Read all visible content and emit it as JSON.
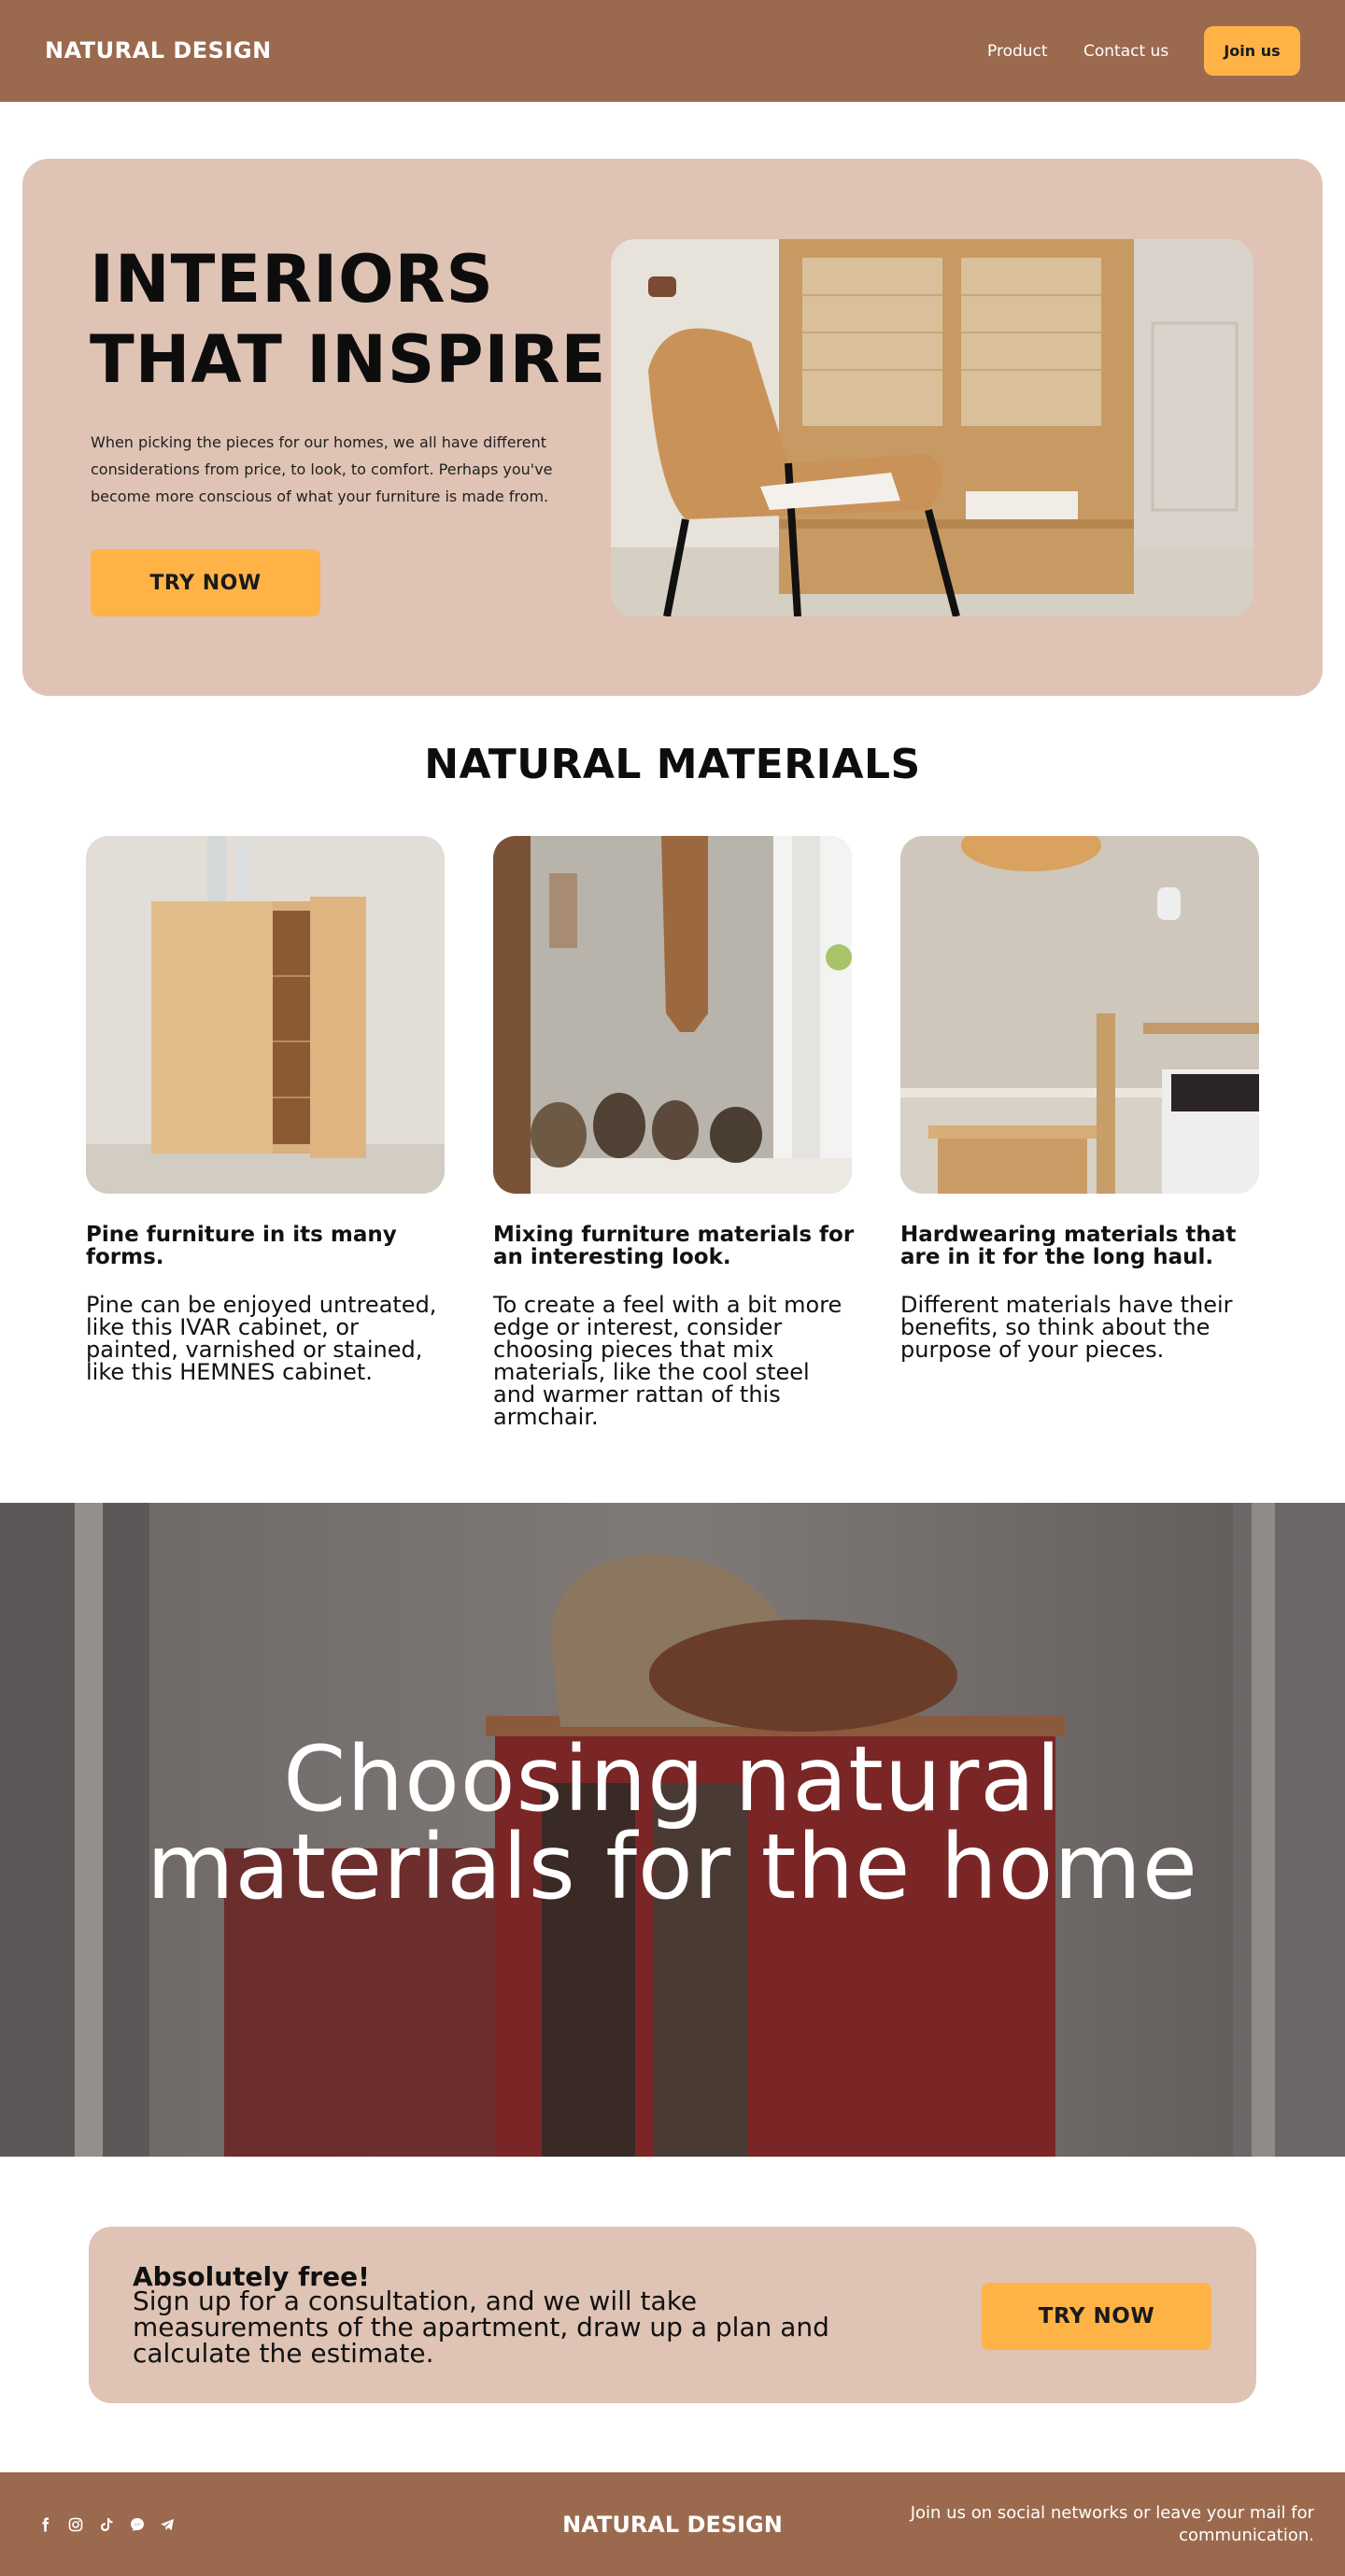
{
  "header": {
    "brand": "NATURAL DESIGN",
    "nav": {
      "product": "Product",
      "contact": "Contact us"
    },
    "join_label": "Join us",
    "bg_color": "#9b6a4e",
    "accent_color": "#ffb347"
  },
  "hero": {
    "title_line1": "INTERIORS",
    "title_line2": "THAT INSPIRE",
    "text": "When picking the pieces for our homes, we all have different considerations from price, to look, to comfort. Perhaps you've become more conscious of what your furniture is made from.",
    "button_label": "TRY NOW",
    "image": "rattan-armchair-and-cabinet-photo",
    "bg_color": "#dfc3b4"
  },
  "materials": {
    "title": "NATURAL MATERIALS",
    "cards": [
      {
        "image": "pine-wall-cabinet-photo",
        "heading": "Pine furniture in its many forms.",
        "text": "Pine can be enjoyed untreated, like this IVAR cabinet, or painted, varnished or stained, like this HEMNES cabinet."
      },
      {
        "image": "kitchen-counter-jars-photo",
        "heading": "Mixing furniture materials for an interesting look.",
        "text": "To create a feel with a bit more edge or interest, consider choosing pieces that mix materials, like the cool steel and warmer rattan of this armchair."
      },
      {
        "image": "bedroom-nightstand-photo",
        "heading": "Hardwearing materials that are in it for the long haul.",
        "text": "Different materials have their benefits, so think about the purpose of your pieces."
      }
    ]
  },
  "banner": {
    "line1": "Choosing natural",
    "line2": "materials for the home",
    "image": "red-cabinet-with-basket-photo"
  },
  "cta": {
    "heading": "Absolutely free!",
    "text": "Sign up for a consultation, and we will take measurements of the apartment, draw up a plan and calculate the estimate.",
    "button_label": "TRY NOW"
  },
  "footer": {
    "brand": "NATURAL DESIGN",
    "note": "Join us on social networks or leave your mail for communication.",
    "social_icons": [
      "facebook-icon",
      "instagram-icon",
      "tiktok-icon",
      "messenger-icon",
      "telegram-icon"
    ]
  }
}
